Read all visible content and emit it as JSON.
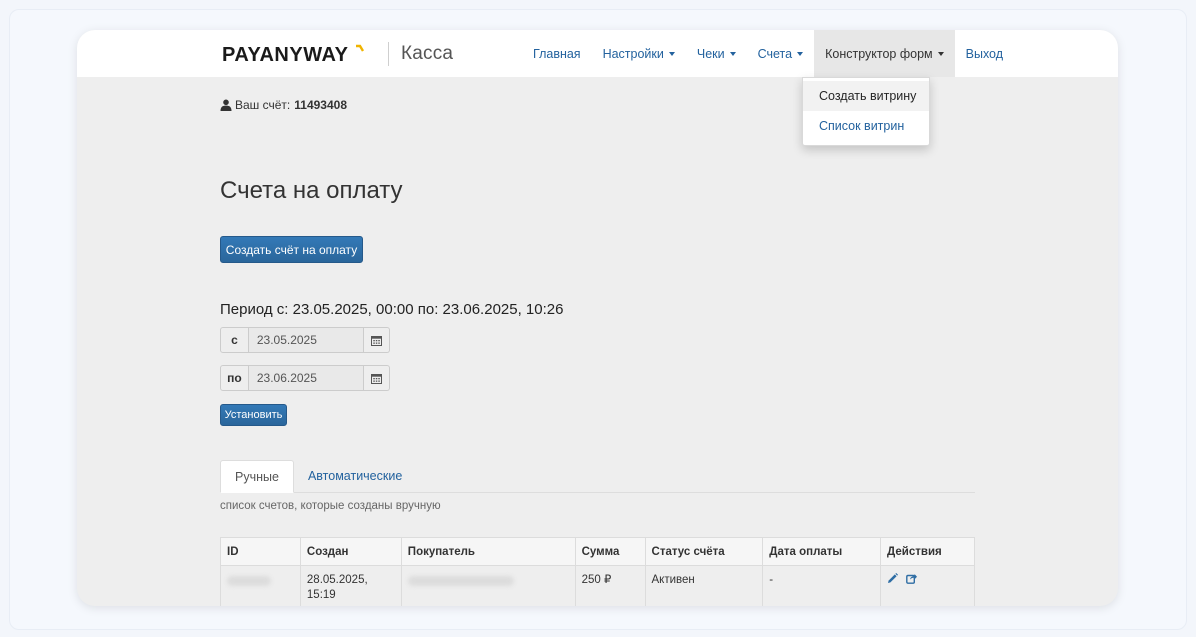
{
  "brand": {
    "logo": "PAYANYWAY",
    "section": "Касса"
  },
  "nav": {
    "items": [
      {
        "label": "Главная"
      },
      {
        "label": "Настройки"
      },
      {
        "label": "Чеки"
      },
      {
        "label": "Счета"
      },
      {
        "label": "Конструктор форм"
      },
      {
        "label": "Выход"
      }
    ],
    "dropdown": [
      {
        "label": "Создать витрину"
      },
      {
        "label": "Список витрин"
      }
    ]
  },
  "account": {
    "label": "Ваш счёт:",
    "number": "11493408"
  },
  "page": {
    "title": "Счета на оплату",
    "create_button": "Создать счёт на оплату",
    "period": "Период с: 23.05.2025, 00:00 по: 23.06.2025, 10:26",
    "from_label": "с",
    "from_value": "23.05.2025",
    "to_label": "по",
    "to_value": "23.06.2025",
    "set_button": "Установить"
  },
  "tabs": [
    {
      "label": "Ручные"
    },
    {
      "label": "Автоматические"
    }
  ],
  "tab_description": "список счетов, которые созданы вручную",
  "table": {
    "headers": [
      "ID",
      "Создан",
      "Покупатель",
      "Сумма",
      "Статус счёта",
      "Дата оплаты",
      "Действия"
    ],
    "rows": [
      {
        "id": "",
        "created_date": "28.05.2025,",
        "created_time": "15:19",
        "buyer": "",
        "amount": "250 ₽",
        "status": "Активен",
        "paid": "-"
      }
    ]
  },
  "colors": {
    "link": "#23629e",
    "primary": "#2e6da4",
    "logo_accent": "#f0b400"
  },
  "icons": {
    "account": "user-icon",
    "calendar": "calendar-icon",
    "edit": "pencil-icon",
    "share": "share-icon"
  }
}
